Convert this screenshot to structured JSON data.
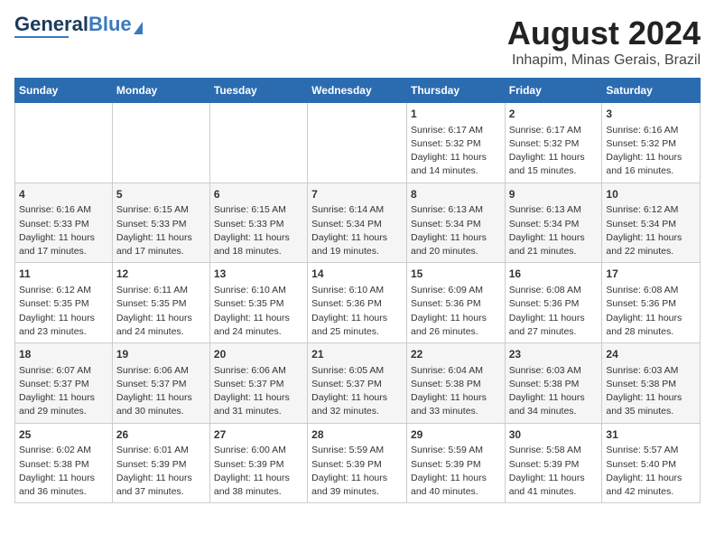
{
  "logo": {
    "line1": "General",
    "line2": "Blue"
  },
  "title": "August 2024",
  "subtitle": "Inhapim, Minas Gerais, Brazil",
  "weekdays": [
    "Sunday",
    "Monday",
    "Tuesday",
    "Wednesday",
    "Thursday",
    "Friday",
    "Saturday"
  ],
  "weeks": [
    [
      {
        "day": "",
        "content": ""
      },
      {
        "day": "",
        "content": ""
      },
      {
        "day": "",
        "content": ""
      },
      {
        "day": "",
        "content": ""
      },
      {
        "day": "1",
        "content": "Sunrise: 6:17 AM\nSunset: 5:32 PM\nDaylight: 11 hours and 14 minutes."
      },
      {
        "day": "2",
        "content": "Sunrise: 6:17 AM\nSunset: 5:32 PM\nDaylight: 11 hours and 15 minutes."
      },
      {
        "day": "3",
        "content": "Sunrise: 6:16 AM\nSunset: 5:32 PM\nDaylight: 11 hours and 16 minutes."
      }
    ],
    [
      {
        "day": "4",
        "content": "Sunrise: 6:16 AM\nSunset: 5:33 PM\nDaylight: 11 hours and 17 minutes."
      },
      {
        "day": "5",
        "content": "Sunrise: 6:15 AM\nSunset: 5:33 PM\nDaylight: 11 hours and 17 minutes."
      },
      {
        "day": "6",
        "content": "Sunrise: 6:15 AM\nSunset: 5:33 PM\nDaylight: 11 hours and 18 minutes."
      },
      {
        "day": "7",
        "content": "Sunrise: 6:14 AM\nSunset: 5:34 PM\nDaylight: 11 hours and 19 minutes."
      },
      {
        "day": "8",
        "content": "Sunrise: 6:13 AM\nSunset: 5:34 PM\nDaylight: 11 hours and 20 minutes."
      },
      {
        "day": "9",
        "content": "Sunrise: 6:13 AM\nSunset: 5:34 PM\nDaylight: 11 hours and 21 minutes."
      },
      {
        "day": "10",
        "content": "Sunrise: 6:12 AM\nSunset: 5:34 PM\nDaylight: 11 hours and 22 minutes."
      }
    ],
    [
      {
        "day": "11",
        "content": "Sunrise: 6:12 AM\nSunset: 5:35 PM\nDaylight: 11 hours and 23 minutes."
      },
      {
        "day": "12",
        "content": "Sunrise: 6:11 AM\nSunset: 5:35 PM\nDaylight: 11 hours and 24 minutes."
      },
      {
        "day": "13",
        "content": "Sunrise: 6:10 AM\nSunset: 5:35 PM\nDaylight: 11 hours and 24 minutes."
      },
      {
        "day": "14",
        "content": "Sunrise: 6:10 AM\nSunset: 5:36 PM\nDaylight: 11 hours and 25 minutes."
      },
      {
        "day": "15",
        "content": "Sunrise: 6:09 AM\nSunset: 5:36 PM\nDaylight: 11 hours and 26 minutes."
      },
      {
        "day": "16",
        "content": "Sunrise: 6:08 AM\nSunset: 5:36 PM\nDaylight: 11 hours and 27 minutes."
      },
      {
        "day": "17",
        "content": "Sunrise: 6:08 AM\nSunset: 5:36 PM\nDaylight: 11 hours and 28 minutes."
      }
    ],
    [
      {
        "day": "18",
        "content": "Sunrise: 6:07 AM\nSunset: 5:37 PM\nDaylight: 11 hours and 29 minutes."
      },
      {
        "day": "19",
        "content": "Sunrise: 6:06 AM\nSunset: 5:37 PM\nDaylight: 11 hours and 30 minutes."
      },
      {
        "day": "20",
        "content": "Sunrise: 6:06 AM\nSunset: 5:37 PM\nDaylight: 11 hours and 31 minutes."
      },
      {
        "day": "21",
        "content": "Sunrise: 6:05 AM\nSunset: 5:37 PM\nDaylight: 11 hours and 32 minutes."
      },
      {
        "day": "22",
        "content": "Sunrise: 6:04 AM\nSunset: 5:38 PM\nDaylight: 11 hours and 33 minutes."
      },
      {
        "day": "23",
        "content": "Sunrise: 6:03 AM\nSunset: 5:38 PM\nDaylight: 11 hours and 34 minutes."
      },
      {
        "day": "24",
        "content": "Sunrise: 6:03 AM\nSunset: 5:38 PM\nDaylight: 11 hours and 35 minutes."
      }
    ],
    [
      {
        "day": "25",
        "content": "Sunrise: 6:02 AM\nSunset: 5:38 PM\nDaylight: 11 hours and 36 minutes."
      },
      {
        "day": "26",
        "content": "Sunrise: 6:01 AM\nSunset: 5:39 PM\nDaylight: 11 hours and 37 minutes."
      },
      {
        "day": "27",
        "content": "Sunrise: 6:00 AM\nSunset: 5:39 PM\nDaylight: 11 hours and 38 minutes."
      },
      {
        "day": "28",
        "content": "Sunrise: 5:59 AM\nSunset: 5:39 PM\nDaylight: 11 hours and 39 minutes."
      },
      {
        "day": "29",
        "content": "Sunrise: 5:59 AM\nSunset: 5:39 PM\nDaylight: 11 hours and 40 minutes."
      },
      {
        "day": "30",
        "content": "Sunrise: 5:58 AM\nSunset: 5:39 PM\nDaylight: 11 hours and 41 minutes."
      },
      {
        "day": "31",
        "content": "Sunrise: 5:57 AM\nSunset: 5:40 PM\nDaylight: 11 hours and 42 minutes."
      }
    ]
  ]
}
